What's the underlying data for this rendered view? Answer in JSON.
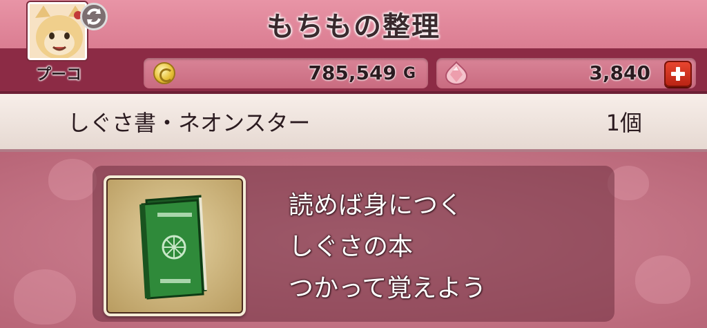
{
  "screen": {
    "title": "もちもの整理"
  },
  "character": {
    "name": "プーコ"
  },
  "currency": {
    "gold_value": "785,549",
    "gold_unit": "G",
    "gem_value": "3,840"
  },
  "item": {
    "name": "しぐさ書・ネオンスター",
    "count": "1個",
    "description": [
      "読めば身につく",
      "しぐさの本",
      "つかって覚えよう"
    ],
    "icon": "green-book-icon"
  },
  "colors": {
    "header_pink": "#e894a6",
    "currency_bar": "#8c2b45",
    "plus_button": "#d23a22",
    "book_green": "#2f8a3a"
  }
}
